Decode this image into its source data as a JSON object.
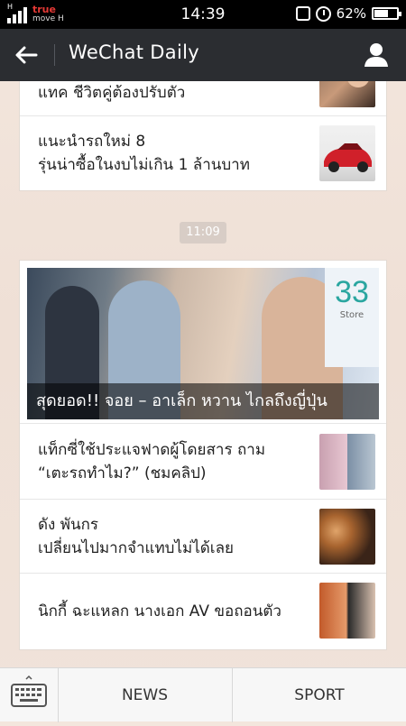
{
  "status_bar": {
    "carrier_line1": "true",
    "carrier_line2": "move H",
    "network_indicator": "H",
    "time": "14:39",
    "battery_percent": "62%",
    "battery_level": 0.62
  },
  "header": {
    "title": "WeChat Daily",
    "back_icon": "arrow-left-icon",
    "profile_icon": "person-icon"
  },
  "messages": {
    "card1": [
      {
        "title": "แทค ชีวิตคู่ต้องปรับตัว"
      },
      {
        "title": "แนะนำรถใหม่ 8\nรุ่นน่าซื้อในงบไม่เกิน 1 ล้านบาท"
      }
    ],
    "time_badge": "11:09",
    "card2": {
      "hero_caption": "สุดยอด!! จอย – อาเล็ก หวาน ไกลถึงญี่ปุ่น",
      "hero_sign_text": "33",
      "hero_sign_sub": "Store",
      "items": [
        {
          "title": "แท็กซี่ใช้ประแจฟาดผู้โดยสาร ถาม\n“เตะรถทำไม?” (ชมคลิป)"
        },
        {
          "title": "ดัง พันกร\nเปลี่ยนไปมากจำแทบไม่ได้เลย"
        },
        {
          "title": "นิกกี้ ฉะแหลก นางเอก AV ขอถอนตัว"
        }
      ]
    }
  },
  "bottom_bar": {
    "keyboard_icon": "keyboard-icon",
    "tabs": [
      {
        "label": "NEWS"
      },
      {
        "label": "SPORT"
      }
    ]
  },
  "colors": {
    "header_bg": "#2b2d31",
    "page_bg": "#f0e3da",
    "carrier_red": "#e53935"
  }
}
